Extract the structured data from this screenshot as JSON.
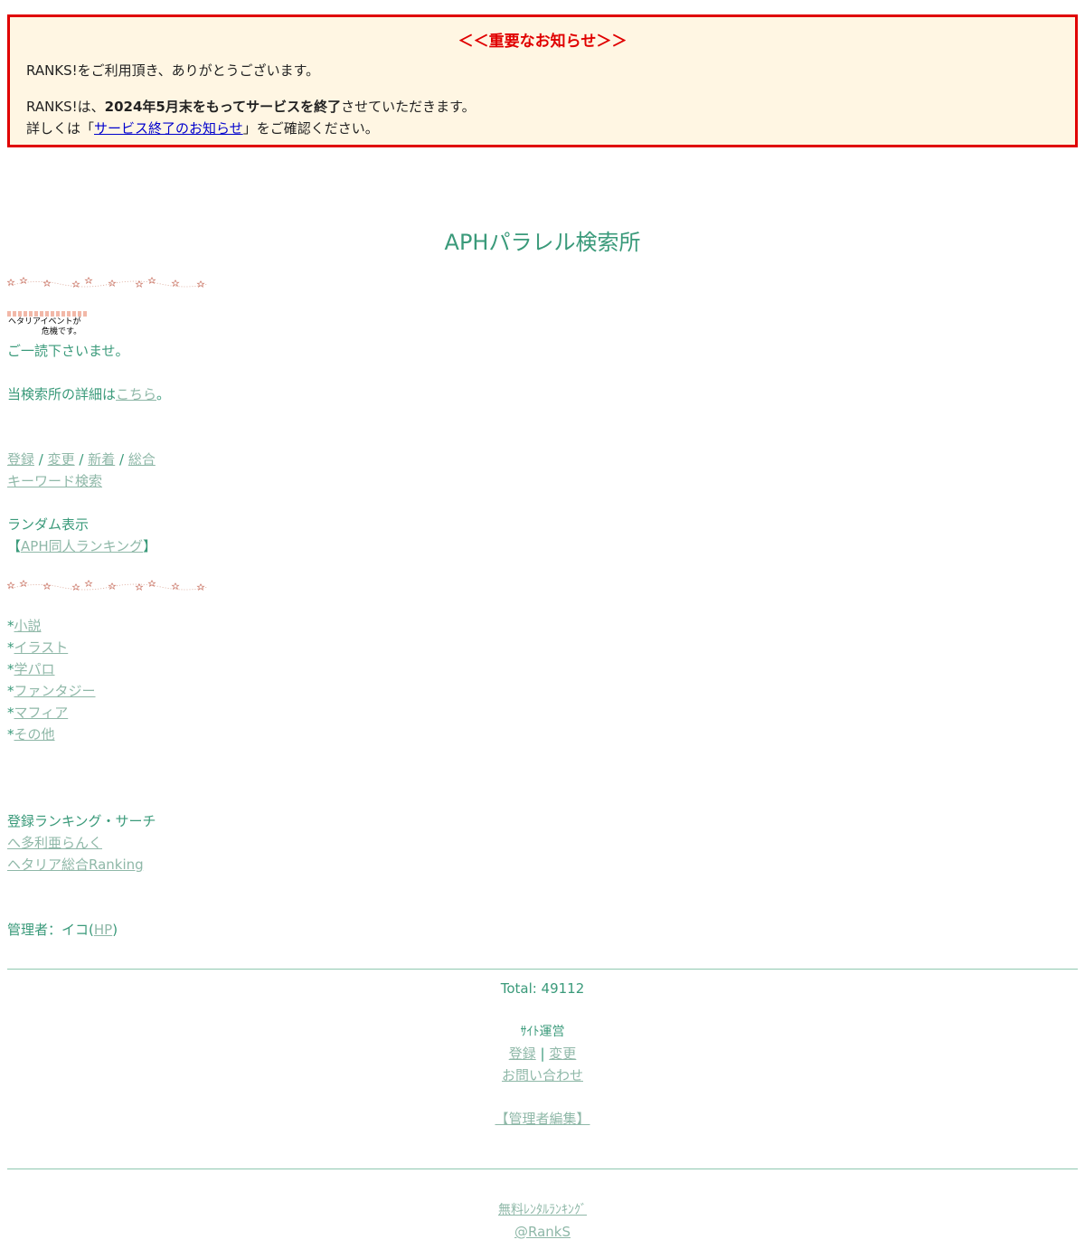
{
  "notice": {
    "title": "＜＜重要なお知らせ＞＞",
    "line1": "RANKS!をご利用頂き、ありがとうございます。",
    "line2_prefix": "RANKS!は、",
    "line2_bold": "2024年5月末をもってサービスを終了",
    "line2_suffix": "させていただきます。",
    "line3_prefix": "詳しくは「",
    "line3_link": "サービス終了のお知らせ",
    "line3_suffix": "」をご確認ください。"
  },
  "site": {
    "title": "APHパラレル検索所"
  },
  "banner": {
    "line1": "ヘタリアイベントが",
    "line2": "危機です。"
  },
  "intro": {
    "read_please": "ご一読下さいませ。",
    "details_prefix": "当検索所の詳細は",
    "details_link": "こちら",
    "details_suffix": "。"
  },
  "nav": {
    "register": "登録",
    "change": "変更",
    "new": "新着",
    "overall": "総合",
    "separator": " / ",
    "keyword_search": "キーワード検索",
    "random": "ランダム表示",
    "doujin_prefix": "【",
    "doujin_link": "APH同人ランキング",
    "doujin_suffix": "】"
  },
  "categories": {
    "bullet": "*",
    "items": [
      "小説",
      "イラスト",
      "学パロ",
      "ファンタジー",
      "マフィア",
      "その他"
    ]
  },
  "ranking_search": {
    "heading": "登録ランキング・サーチ",
    "links": [
      "へ多利亜らんく",
      "ヘタリア総合Ranking"
    ]
  },
  "admin": {
    "prefix": "管理者：イコ(",
    "link": "HP",
    "suffix": ")"
  },
  "footer": {
    "total": "Total: 49112",
    "site_ops": "ｻｲﾄ運営",
    "register": "登録",
    "pipe": " | ",
    "change": "変更",
    "contact": "お問い合わせ",
    "admin_edit": "【管理者編集】",
    "free_ranking": "無料ﾚﾝﾀﾙﾗﾝｷﾝｸﾞ",
    "ranks": "@RankS"
  },
  "colors": {
    "text": "#3a9a7a",
    "link": "#8fb8a8",
    "notice_border": "#e00000",
    "notice_bg": "#fff6e3"
  }
}
